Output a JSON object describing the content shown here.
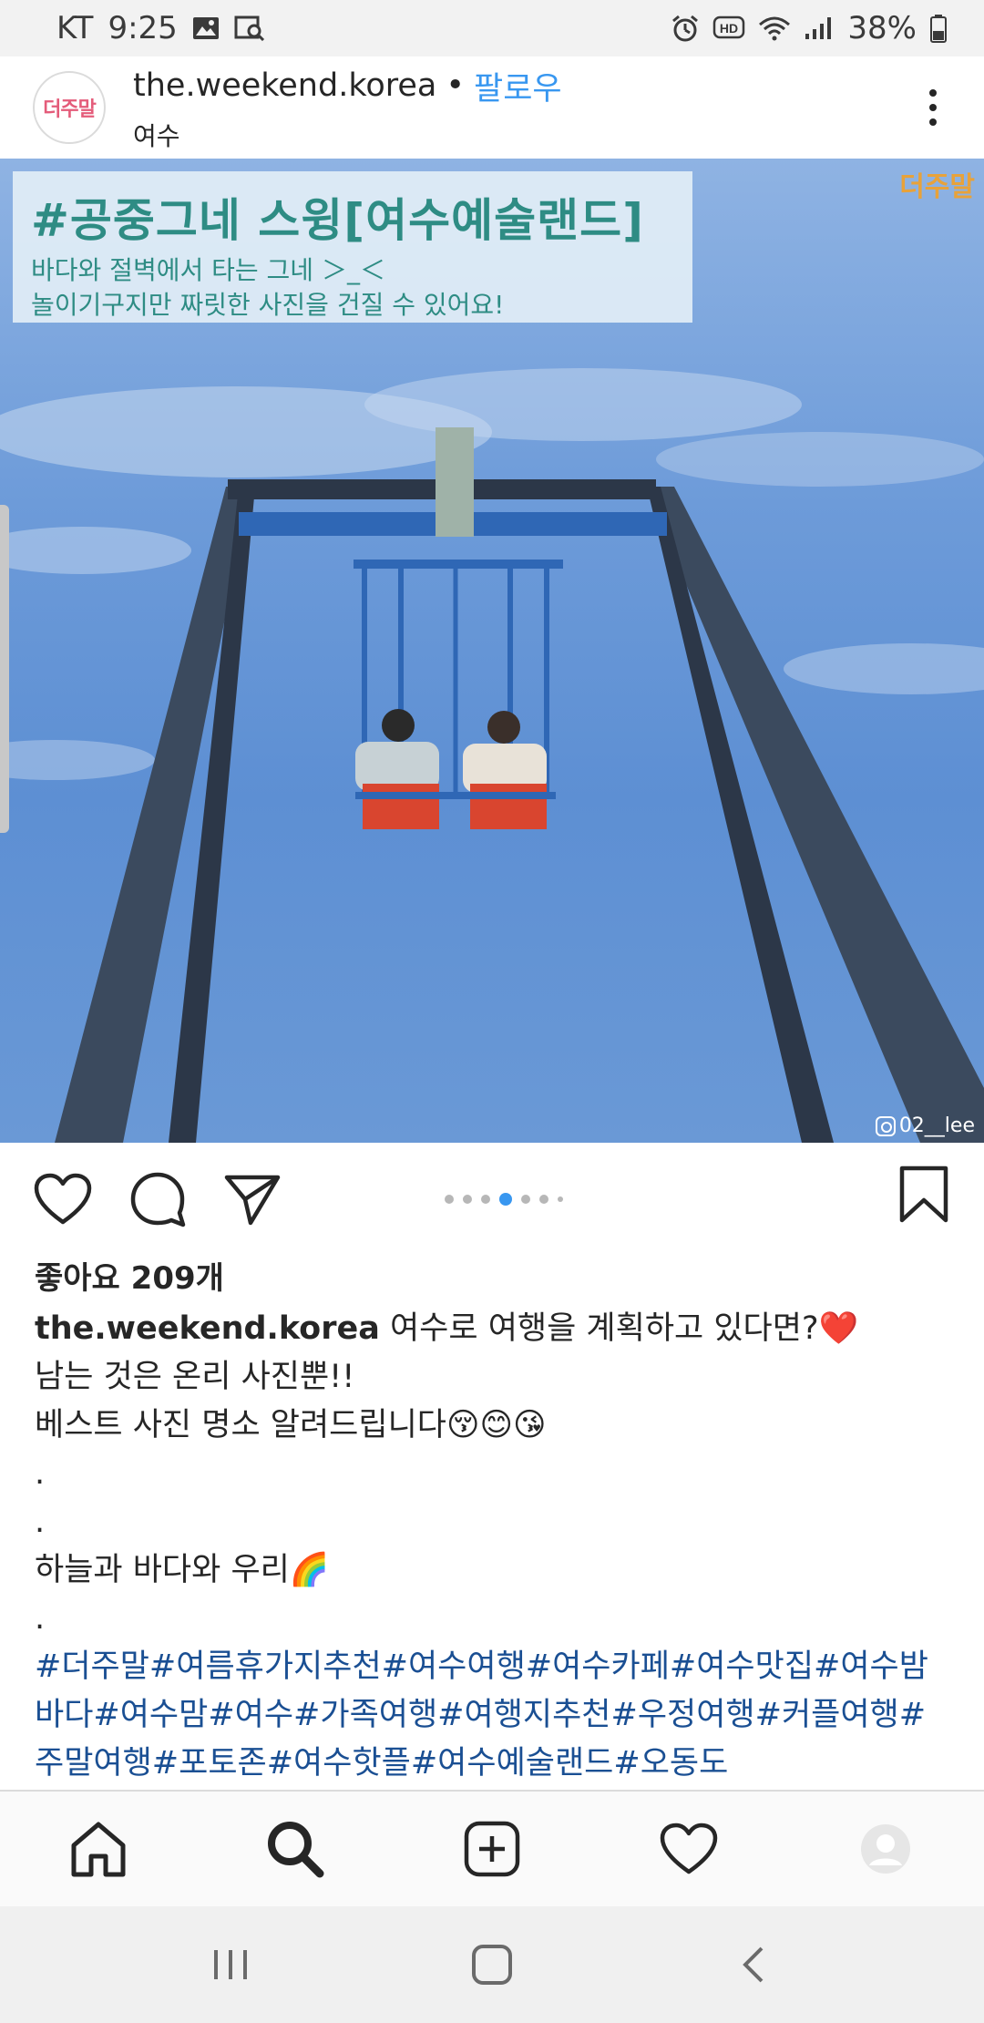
{
  "status_bar": {
    "carrier": "KT",
    "time": "9:25",
    "battery": "38%",
    "icons": [
      "image-icon",
      "gallery-search-icon",
      "alarm-icon",
      "hd-icon",
      "wifi-icon",
      "signal-icon",
      "battery-icon"
    ]
  },
  "post_header": {
    "avatar_text": "더주말",
    "username": "the.weekend.korea",
    "separator": "•",
    "follow_label": "팔로우",
    "location": "여수"
  },
  "image": {
    "title": "#공중그네 스윙[여수예술랜드]",
    "subtitle_line1": "바다와 절벽에서 타는 그네 ＞_＜",
    "subtitle_line2": "놀이기구지만 짜릿한 사진을 건질 수 있어요!",
    "corner_logo": "더주말",
    "watermark": "02__lee",
    "sky_color": "#6d9bd9",
    "frame_color": "#3b4a5e",
    "beam_color": "#2f67b5"
  },
  "actions": {
    "icons": [
      "heart-icon",
      "comment-icon",
      "share-icon",
      "bookmark-icon"
    ],
    "carousel_total": 7,
    "carousel_active": 4
  },
  "likes": "좋아요 209개",
  "caption": {
    "username": "the.weekend.korea",
    "line1": "여수로 여행을 계획하고 있다면?❤️",
    "line2": "남는 것은 온리 사진뿐!!",
    "line3": "베스트 사진 명소 알려드립니다😚😊😘",
    "dot1": ".",
    "dot2": ".",
    "line4": "하늘과 바다와 우리🌈",
    "dot3": ".",
    "hashtags": "#더주말#여름휴가지추천#여수여행#여수카페#여수맛집#여수밤바다#여수맘#여수#가족여행#여행지추천#우정여행#커플여행#주말여행#포토존#여수핫플#여수예술랜드#오동도"
  },
  "tab_bar": {
    "icons": [
      "home-icon",
      "search-icon",
      "add-post-icon",
      "activity-heart-icon",
      "profile-icon"
    ]
  },
  "nav_bar": {
    "icons": [
      "recent-apps-icon",
      "home-button-icon",
      "back-icon"
    ]
  }
}
